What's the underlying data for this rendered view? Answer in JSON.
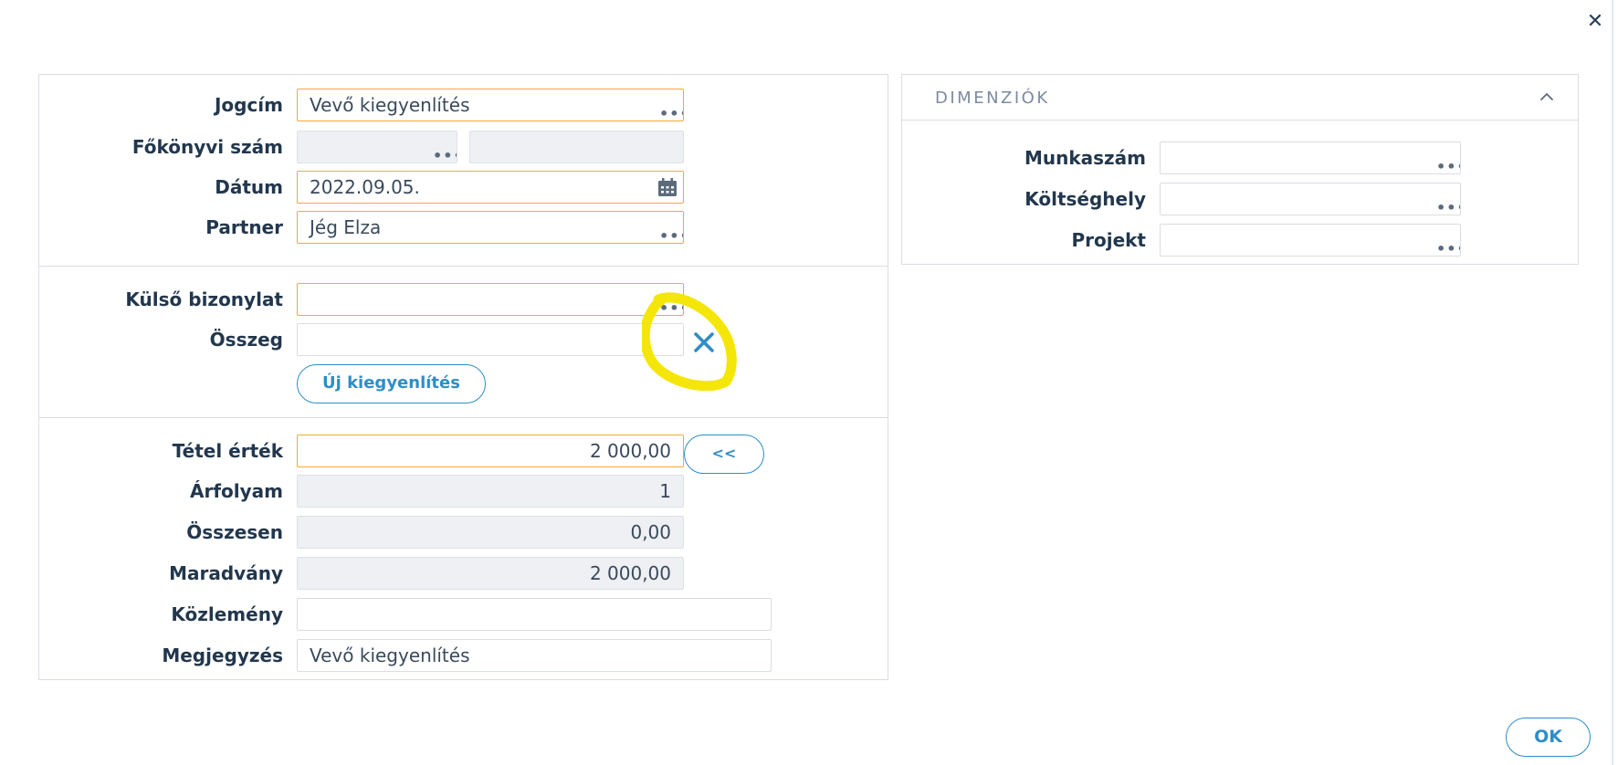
{
  "dialog": {
    "close_icon": "close-icon",
    "ok_label": "OK"
  },
  "form": {
    "jogcim": {
      "label": "Jogcím",
      "value": "Vevő kiegyenlítés"
    },
    "fokonyvi": {
      "label": "Főkönyvi szám",
      "value": "",
      "value2": ""
    },
    "datum": {
      "label": "Dátum",
      "value": "2022.09.05."
    },
    "partner": {
      "label": "Partner",
      "value": "Jég Elza"
    },
    "kulso": {
      "label": "Külső bizonylat",
      "value": ""
    },
    "osszeg": {
      "label": "Összeg",
      "value": ""
    },
    "uj_button": "Új kiegyenlítés",
    "tetel": {
      "label": "Tétel érték",
      "value": "2 000,00"
    },
    "back_button": "<<",
    "arfolyam": {
      "label": "Árfolyam",
      "value": "1"
    },
    "osszesen": {
      "label": "Összesen",
      "value": "0,00"
    },
    "maradvany": {
      "label": "Maradvány",
      "value": "2 000,00"
    },
    "kozlemeny": {
      "label": "Közlemény",
      "value": ""
    },
    "megjegyzes": {
      "label": "Megjegyzés",
      "value": "Vevő kiegyenlítés"
    }
  },
  "dimensions": {
    "title": "DIMENZIÓK",
    "munkaszam": {
      "label": "Munkaszám",
      "value": ""
    },
    "koltseghely": {
      "label": "Költséghely",
      "value": ""
    },
    "projekt": {
      "label": "Projekt",
      "value": ""
    }
  },
  "colors": {
    "required_border": "#f3a93c",
    "accent": "#2e8ec7",
    "highlight": "#f5e60a"
  }
}
